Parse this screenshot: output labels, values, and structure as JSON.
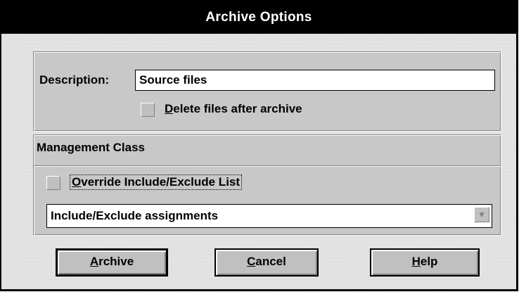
{
  "dialog": {
    "title": "Archive Options"
  },
  "description": {
    "label": "Description:",
    "value": "Source files",
    "delete_checkbox": {
      "mnemonic": "D",
      "rest": "elete files after archive",
      "checked": false
    }
  },
  "management_class": {
    "title": "Management Class",
    "override_checkbox": {
      "mnemonic": "O",
      "rest": "verride Include/Exclude List",
      "checked": false
    },
    "dropdown": {
      "selected": "Include/Exclude assignments",
      "arrow_icon": "down-arrow-icon"
    }
  },
  "buttons": {
    "archive": {
      "mnemonic": "A",
      "rest": "rchive"
    },
    "cancel": {
      "mnemonic": "C",
      "rest": "ancel"
    },
    "help": {
      "mnemonic": "H",
      "rest": "elp"
    }
  },
  "colors": {
    "titlebar_bg": "#000000",
    "titlebar_text": "#ffffff",
    "dialog_bg": "#d4d4d4",
    "field_bg": "#ffffff"
  }
}
